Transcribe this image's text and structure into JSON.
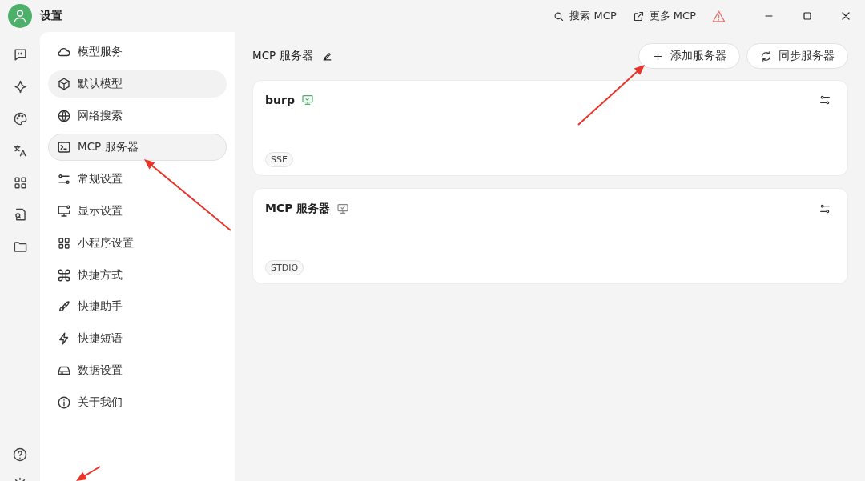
{
  "window": {
    "title": "设置"
  },
  "toolbar": [
    {
      "label": "搜索 MCP"
    },
    {
      "label": "更多 MCP"
    }
  ],
  "sidebar": {
    "items": [
      {
        "label": "模型服务",
        "selected": false,
        "hovered": false
      },
      {
        "label": "默认模型",
        "selected": false,
        "hovered": true
      },
      {
        "label": "网络搜索",
        "selected": false,
        "hovered": false
      },
      {
        "label": "MCP 服务器",
        "selected": true,
        "hovered": false
      },
      {
        "label": "常规设置",
        "selected": false,
        "hovered": false
      },
      {
        "label": "显示设置",
        "selected": false,
        "hovered": false
      },
      {
        "label": "小程序设置",
        "selected": false,
        "hovered": false
      },
      {
        "label": "快捷方式",
        "selected": false,
        "hovered": false
      },
      {
        "label": "快捷助手",
        "selected": false,
        "hovered": false
      },
      {
        "label": "快捷短语",
        "selected": false,
        "hovered": false
      },
      {
        "label": "数据设置",
        "selected": false,
        "hovered": false
      },
      {
        "label": "关于我们",
        "selected": false,
        "hovered": false
      }
    ]
  },
  "content": {
    "title": "MCP 服务器",
    "buttons": [
      {
        "label": "添加服务器"
      },
      {
        "label": "同步服务器"
      }
    ],
    "servers": [
      {
        "name": "burp",
        "active": true,
        "type": "SSE"
      },
      {
        "name": "MCP 服务器",
        "active": false,
        "type": "STDIO"
      }
    ]
  }
}
